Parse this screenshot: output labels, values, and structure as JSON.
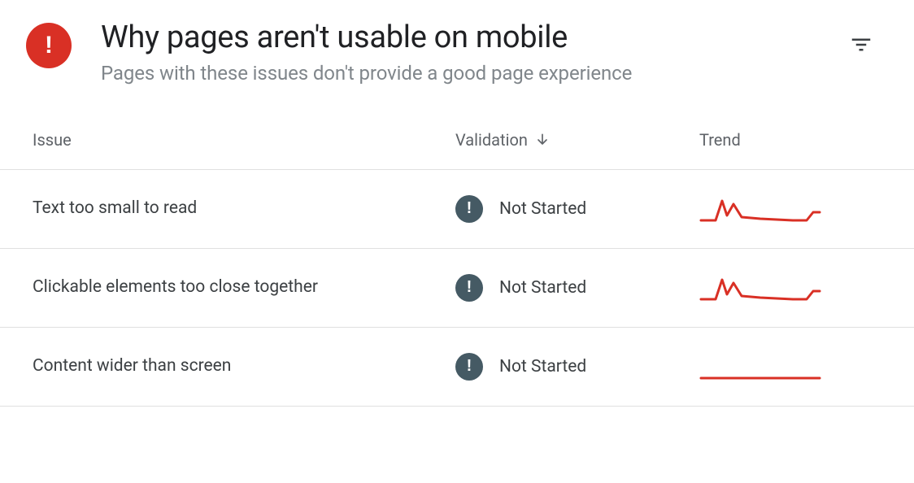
{
  "header": {
    "title": "Why pages aren't usable on mobile",
    "subtitle": "Pages with these issues don't provide a good page experience"
  },
  "columns": {
    "issue": "Issue",
    "validation": "Validation",
    "trend": "Trend"
  },
  "rows": [
    {
      "issue": "Text too small to read",
      "validation_status": "Not Started",
      "trend_shape": "spike"
    },
    {
      "issue": "Clickable elements too close together",
      "validation_status": "Not Started",
      "trend_shape": "spike"
    },
    {
      "issue": "Content wider than screen",
      "validation_status": "Not Started",
      "trend_shape": "flat"
    }
  ],
  "colors": {
    "error": "#d93025",
    "status_dot": "#455a64",
    "trend": "#d93025"
  }
}
